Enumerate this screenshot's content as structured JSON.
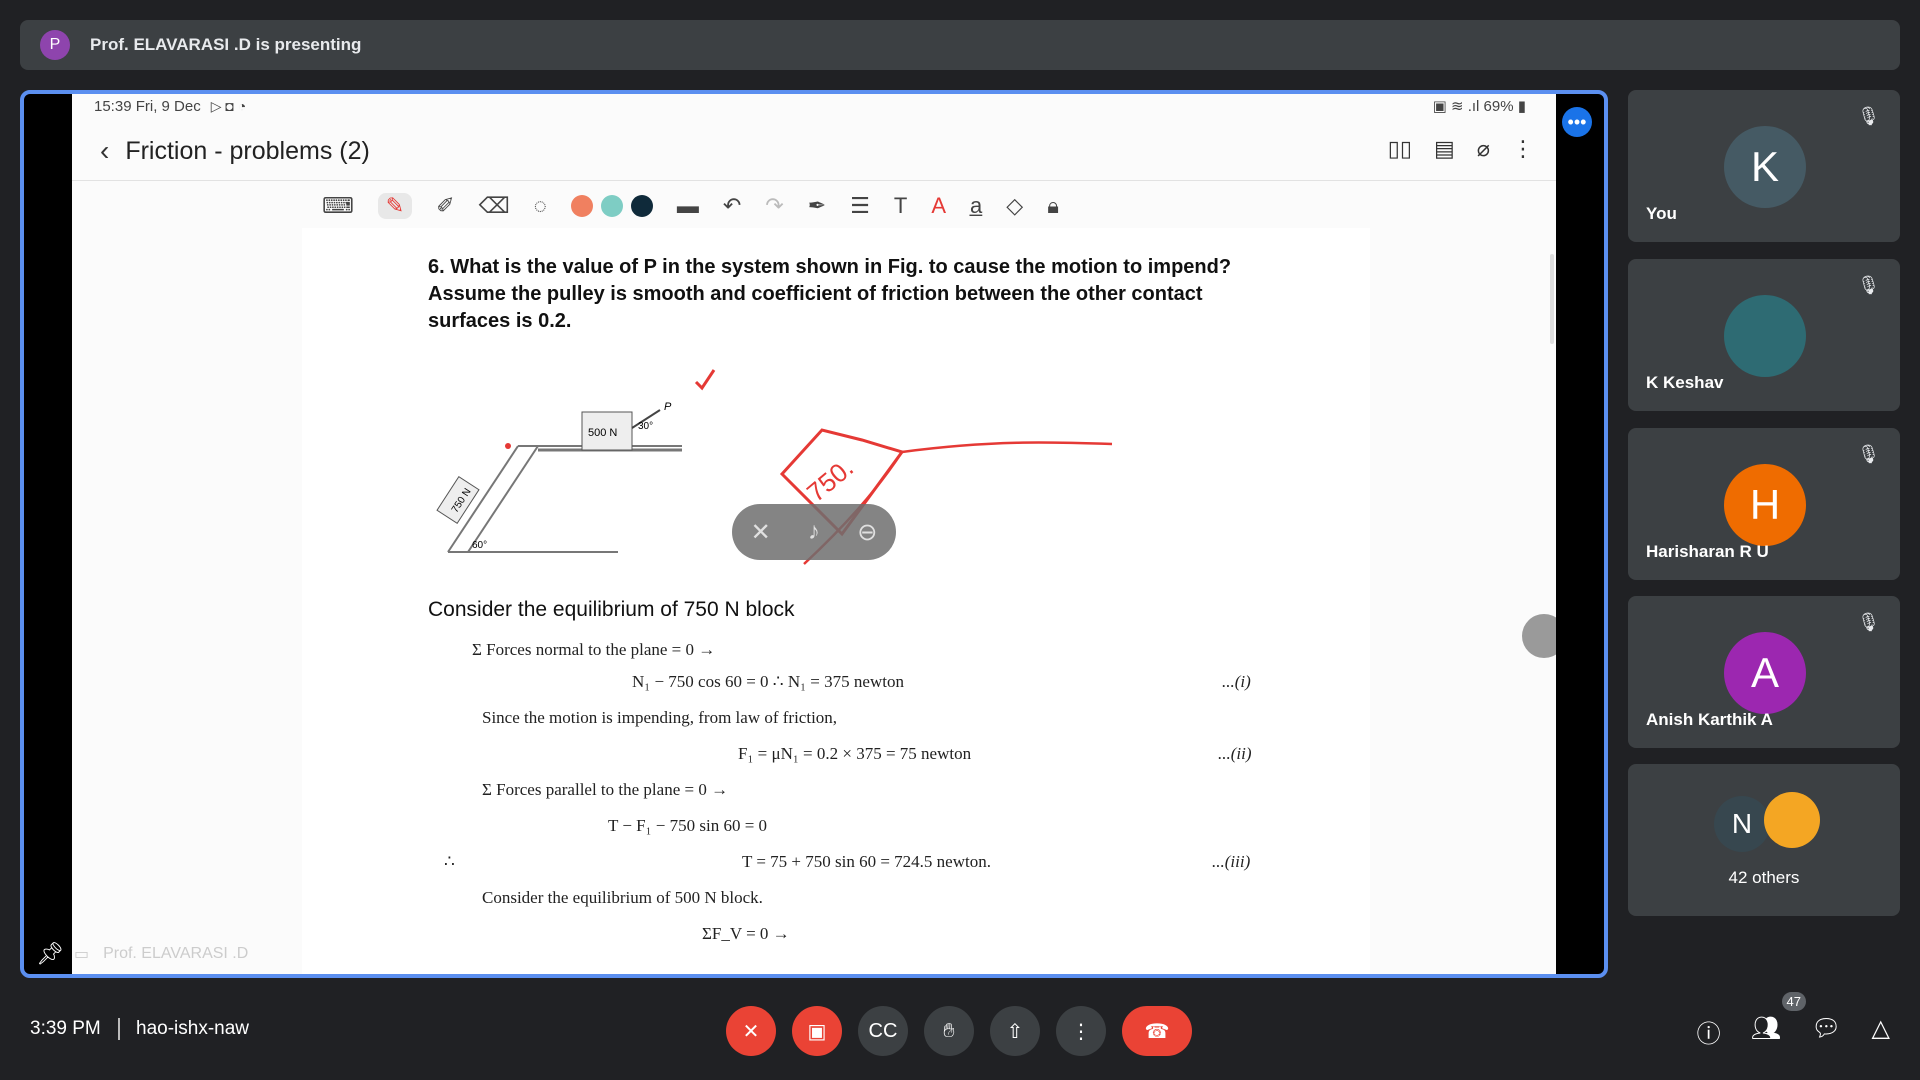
{
  "banner": {
    "avatar_letter": "P",
    "text": "Prof. ELAVARASI .D is presenting"
  },
  "screen": {
    "status_time": "15:39  Fri, 9 Dec",
    "status_battery": "69%",
    "title": "Friction - problems (2)",
    "question": "6. What is the value of P in the system shown in Fig. to cause the motion to impend? Assume the pulley is smooth and coefficient of friction between the other contact surfaces is 0.2.",
    "consider_750": "Consider the equilibrium of 750 N block",
    "eq1_head": "Σ Forces normal to the plane = 0 →",
    "eq1": "N₁ − 750 cos 60 = 0   ∴  N₁ = 375 newton",
    "eq1_tag": "...(i)",
    "since": "Since the motion is impending, from law of friction,",
    "eq2": "F₁ = μN₁ = 0.2 × 375 = 75 newton",
    "eq2_tag": "...(ii)",
    "eq3_head": "Σ Forces parallel to the plane = 0 →",
    "eq3": "T − F₁ − 750 sin 60 = 0",
    "therefore": "∴",
    "eq4": "T = 75 + 750 sin 60 = 724.5 newton.",
    "eq4_tag": "...(iii)",
    "consider_500": "Consider the equilibrium of 500 N block.",
    "eq5": "ΣF_V  = 0 →",
    "fig_500": "500 N",
    "fig_750": "750 N",
    "fig_30": "30°",
    "fig_60": "60°",
    "fig_p": "P",
    "annot_750": "750.",
    "colors": [
      "#f08060",
      "#7ecdc4",
      "#0f2a3a"
    ]
  },
  "stage_footer": {
    "presenter": "Prof. ELAVARASI .D"
  },
  "participants": [
    {
      "name": "You",
      "letter": "K",
      "color": "#455a64"
    },
    {
      "name": "K Keshav",
      "letter": "",
      "color": "#2e6b73"
    },
    {
      "name": "Harisharan R U",
      "letter": "H",
      "color": "#ef6c00"
    },
    {
      "name": "Anish Karthik A",
      "letter": "A",
      "color": "#9c27b0"
    }
  ],
  "others": {
    "letter": "N",
    "label": "42 others"
  },
  "bottom": {
    "clock": "3:39 PM",
    "meeting_code": "hao-ishx-naw",
    "people_count": "47"
  }
}
